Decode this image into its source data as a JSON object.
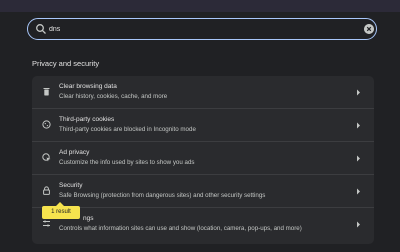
{
  "search": {
    "value": "dns"
  },
  "section": {
    "title": "Privacy and security"
  },
  "rows": [
    {
      "title": "Clear browsing data",
      "subtitle": "Clear history, cookies, cache, and more"
    },
    {
      "title": "Third-party cookies",
      "subtitle": "Third-party cookies are blocked in Incognito mode"
    },
    {
      "title": "Ad privacy",
      "subtitle": "Customize the info used by sites to show you ads"
    },
    {
      "title": "Security",
      "subtitle": "Safe Browsing (protection from dangerous sites) and other security settings"
    },
    {
      "title_partial": "ngs",
      "subtitle": "Controls what information sites can use and show (location, camera, pop-ups, and more)"
    }
  ],
  "tooltip": {
    "text": "1 result"
  },
  "colors": {
    "highlight": "#f6e34e",
    "focus_ring": "#a8c7fa",
    "card": "#2a2b2e"
  }
}
